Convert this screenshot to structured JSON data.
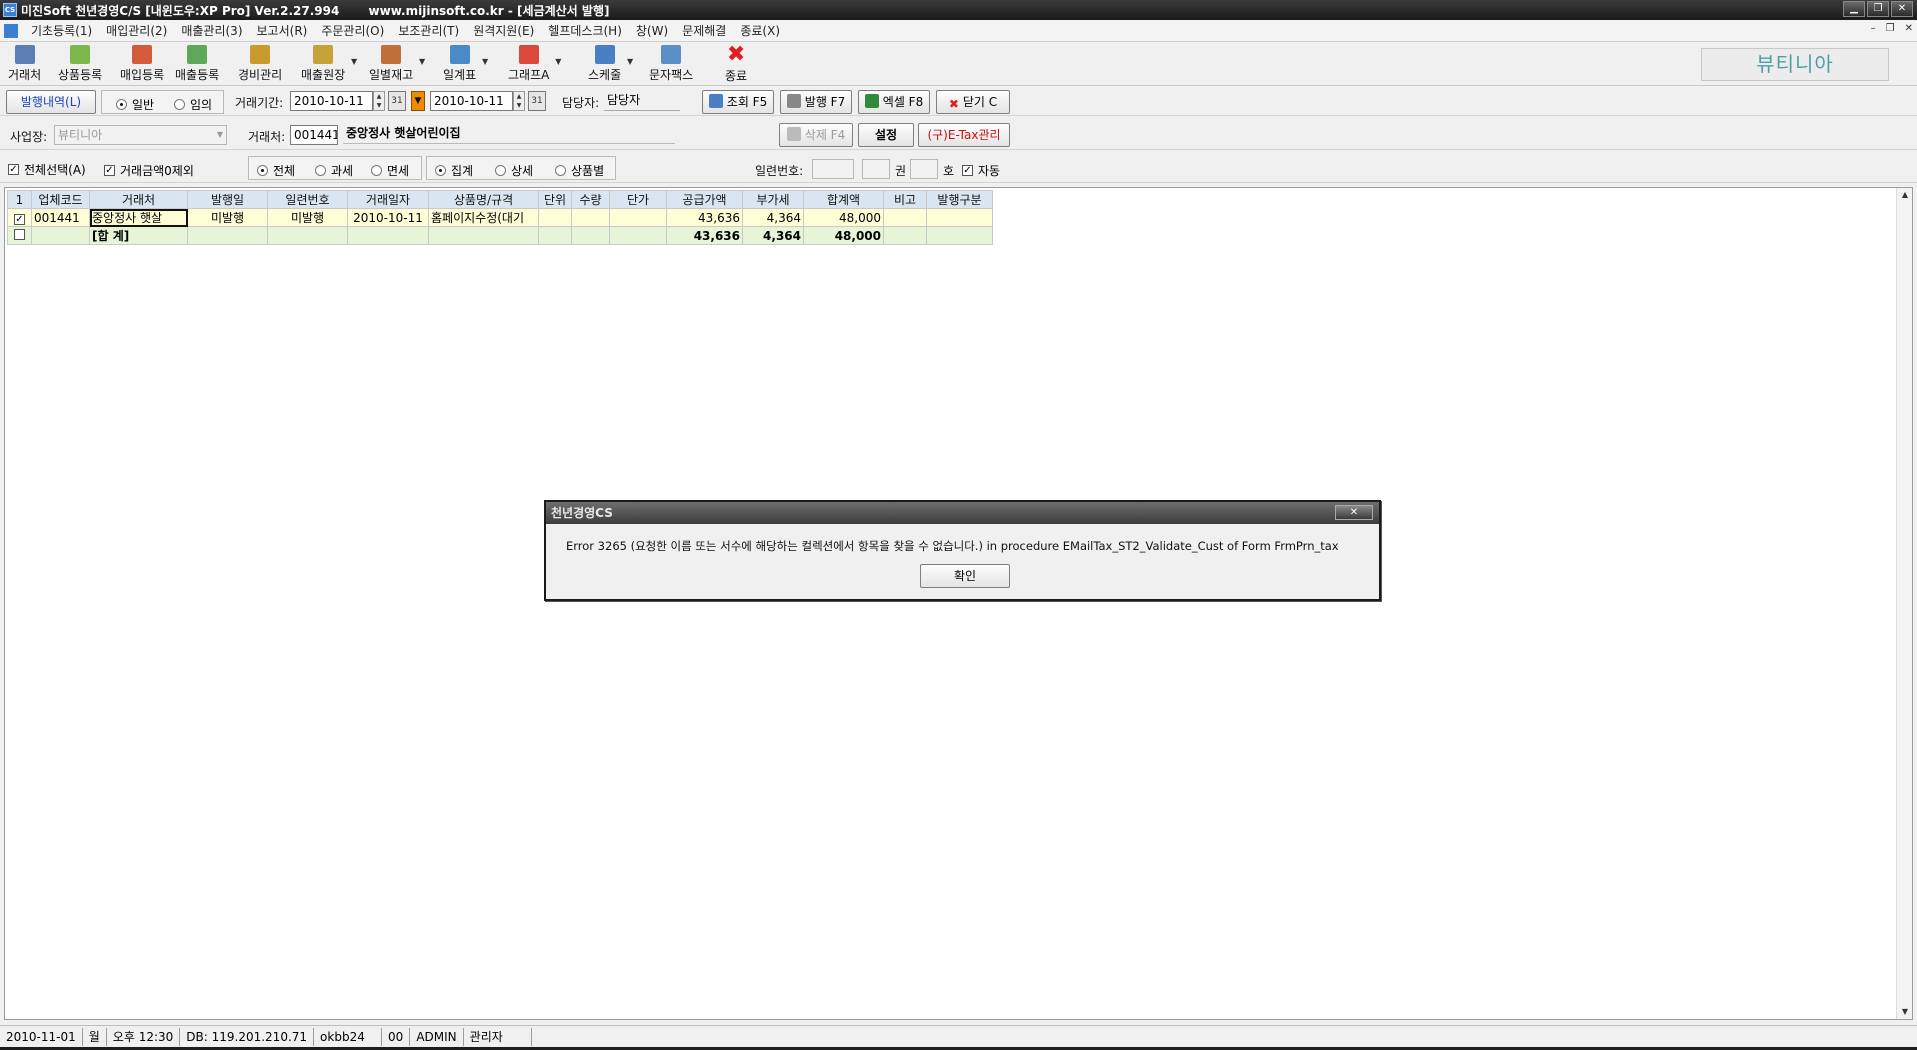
{
  "window": {
    "title": "미진Soft 천년경영C/S [내윈도우:XP Pro] Ver.2.27.994       www.mijinsoft.co.kr - [세금계산서 발행]",
    "icon_text": "CS",
    "controls": [
      "▁",
      "❐",
      "✕"
    ]
  },
  "menu": {
    "items": [
      "기초등록(1)",
      "매입관리(2)",
      "매출관리(3)",
      "보고서(R)",
      "주문관리(O)",
      "보조관리(T)",
      "원격지원(E)",
      "헬프데스크(H)",
      "창(W)",
      "문제해결",
      "종료(X)"
    ],
    "mdi_controls": [
      "–",
      "❐",
      "✕"
    ]
  },
  "toolbar": {
    "buttons": [
      {
        "label": "거래처",
        "icon": "ledger-icon",
        "color": "#5b7fb4"
      },
      {
        "label": "상품등록",
        "icon": "product-icon",
        "color": "#7db94a"
      },
      {
        "label": "매입등록",
        "icon": "purchase-icon",
        "color": "#d45a3a"
      },
      {
        "label": "매출등록",
        "icon": "sales-icon",
        "color": "#5fa85a"
      },
      {
        "label": "경비관리",
        "icon": "expense-icon",
        "color": "#c99a2e"
      },
      {
        "label": "매출원장",
        "icon": "sales-ledger-icon",
        "color": "#c7a23a"
      },
      {
        "label": "일별재고",
        "icon": "stock-icon",
        "color": "#c0703a"
      },
      {
        "label": "일계표",
        "icon": "daily-sheet-icon",
        "color": "#4a8ac9"
      },
      {
        "label": "그래프A",
        "icon": "graph-icon",
        "color": "#d9483b"
      },
      {
        "label": "스케줄",
        "icon": "schedule-icon",
        "color": "#4a7fc4"
      },
      {
        "label": "문자팩스",
        "icon": "sms-fax-icon",
        "color": "#5a8fc8"
      },
      {
        "label": "종료",
        "icon": "exit-icon",
        "color": "#e02020"
      }
    ],
    "brand": "뷰티니아"
  },
  "filters": {
    "issue_history_button": "발행내역(L)",
    "mode_options": [
      "일반",
      "임의"
    ],
    "mode_selected": "일반",
    "period_label": "거래기간:",
    "date_from": "2010-10-11",
    "date_to": "2010-10-11",
    "calendar_glyph": "31",
    "manager_label": "담당자:",
    "manager_value": "담당자",
    "search_button": "조회 F5",
    "issue_button": "발행 F7",
    "excel_button": "엑셀 F8",
    "close_button": "닫기 C",
    "site_label": "사업장:",
    "site_value": "뷰티니아",
    "client_label": "거래처:",
    "client_code": "001441",
    "client_name": "중앙정사 햇살어린이집",
    "delete_button": "삭제 F4",
    "settings_button": "설정",
    "etax_button": "(구)E-Tax관리",
    "select_all": "전체선택(A)",
    "exclude_zero": "거래금액0제외",
    "tax_options": [
      "전체",
      "과세",
      "면세"
    ],
    "tax_selected": "전체",
    "view_options": [
      "집계",
      "상세",
      "상품별"
    ],
    "view_selected": "집계",
    "serial_label": "일련번호:",
    "serial_vol_unit": "권",
    "serial_no_unit": "호",
    "auto_label": "자동"
  },
  "grid": {
    "columns": [
      "1",
      "업체코드",
      "거래처",
      "발행일",
      "일련번호",
      "거래일자",
      "상품명/규격",
      "단위",
      "수량",
      "단가",
      "공급가액",
      "부가세",
      "합계액",
      "비고",
      "발행구분"
    ],
    "rows": [
      {
        "checked": true,
        "code": "001441",
        "client": "중앙정사 햇살",
        "issue_date": "미발행",
        "serial": "미발행",
        "trade_date": "2010-10-11",
        "item": "홈페이지수정(대기",
        "unit": "",
        "qty": "",
        "price": "",
        "supply": "43,636",
        "vat": "4,364",
        "total": "48,000",
        "note": "",
        "issue_type": ""
      }
    ],
    "total_row": {
      "checked": false,
      "label": "[합 계]",
      "supply": "43,636",
      "vat": "4,364",
      "total": "48,000"
    }
  },
  "dialog": {
    "title": "천년경영CS",
    "close": "✕",
    "message": "Error 3265 (요청한 이름 또는 서수에 해당하는 컬렉션에서 항목을 찾을 수 없습니다.) in procedure EMailTax_ST2_Validate_Cust of Form FrmPrn_tax",
    "ok_button": "확인"
  },
  "status": {
    "date": "2010-11-01",
    "weekday": "월",
    "time": "오후 12:30",
    "db": "DB: 119.201.210.71",
    "db_user": "okbb24",
    "code": "00",
    "user": "ADMIN",
    "role": "관리자"
  }
}
